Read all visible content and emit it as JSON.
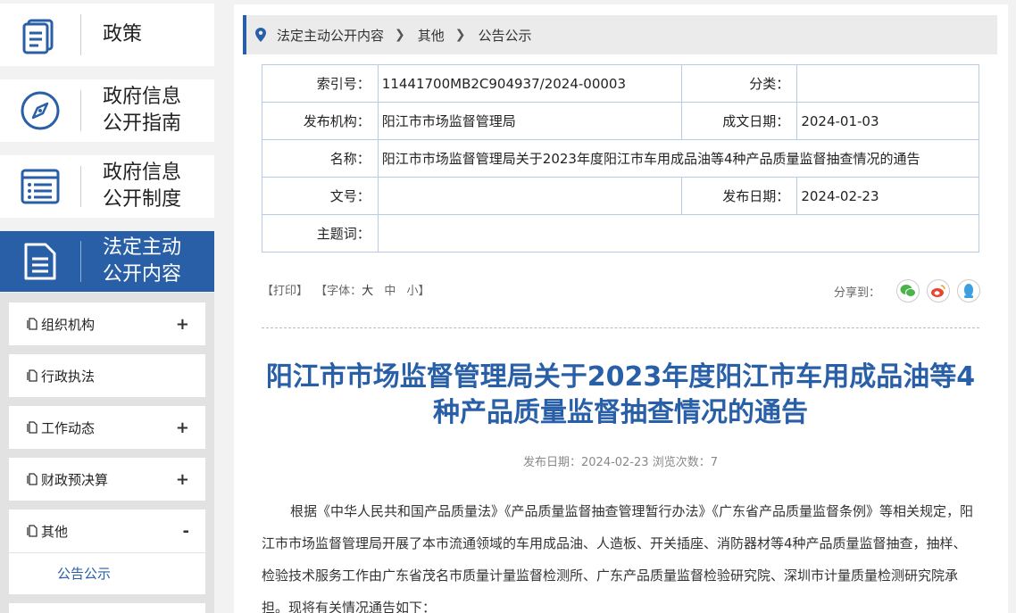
{
  "sidebar": {
    "nav": [
      {
        "label": "政策",
        "icon": "document-list-icon"
      },
      {
        "label": "政府信息\n公开指南",
        "icon": "compass-icon"
      },
      {
        "label": "政府信息\n公开制度",
        "icon": "list-icon"
      },
      {
        "label": "法定主动\n公开内容",
        "icon": "document-icon",
        "active": true
      }
    ],
    "sub": [
      {
        "label": "组织机构",
        "toggle": "+"
      },
      {
        "label": "行政执法",
        "toggle": ""
      },
      {
        "label": "工作动态",
        "toggle": "+"
      },
      {
        "label": "财政预决算",
        "toggle": "+"
      },
      {
        "label": "其他",
        "toggle": "-"
      }
    ],
    "sub_child": "公告公示"
  },
  "breadcrumb": [
    "法定主动公开内容",
    "其他",
    "公告公示"
  ],
  "meta": {
    "index_label": "索引号：",
    "index_value": "11441700MB2C904937/2024-00003",
    "category_label": "分类：",
    "category_value": "",
    "publisher_label": "发布机构：",
    "publisher_value": "阳江市市场监督管理局",
    "created_label": "成文日期：",
    "created_value": "2024-01-03",
    "name_label": "名称：",
    "name_value": "阳江市市场监督管理局关于2023年度阳江市车用成品油等4种产品质量监督抽查情况的通告",
    "docno_label": "文号：",
    "docno_value": "",
    "pubdate_label": "发布日期：",
    "pubdate_value": "2024-02-23",
    "keywords_label": "主题词：",
    "keywords_value": ""
  },
  "tools": {
    "print": "【打印】",
    "font_prefix": "【字体：",
    "font_large": "大",
    "font_medium": "中",
    "font_small": "小",
    "font_suffix": "】"
  },
  "share": {
    "label": "分享到：",
    "icons": [
      "wechat-icon",
      "weibo-icon",
      "qq-icon"
    ]
  },
  "article": {
    "title": "阳江市市场监督管理局关于2023年度阳江市车用成品油等4种产品质量监督抽查情况的通告",
    "pubinfo": "发布日期：2024-02-23  浏览次数：7",
    "body": "根据《中华人民共和国产品质量法》《产品质量监督抽查管理暂行办法》《广东省产品质量监督条例》等相关规定，阳江市市场监督管理局开展了本市流通领域的车用成品油、人造板、开关插座、消防器材等4种产品质量监督抽查，抽样、检验技术服务工作由广东省茂名市质量计量监督检测所、广东产品质量监督检验研究院、深圳市计量质量检测研究院承担。现将有关情况通告如下："
  },
  "colors": {
    "accent": "#285fa7",
    "border": "#b5cbe6",
    "background": "#f2f2f2"
  }
}
